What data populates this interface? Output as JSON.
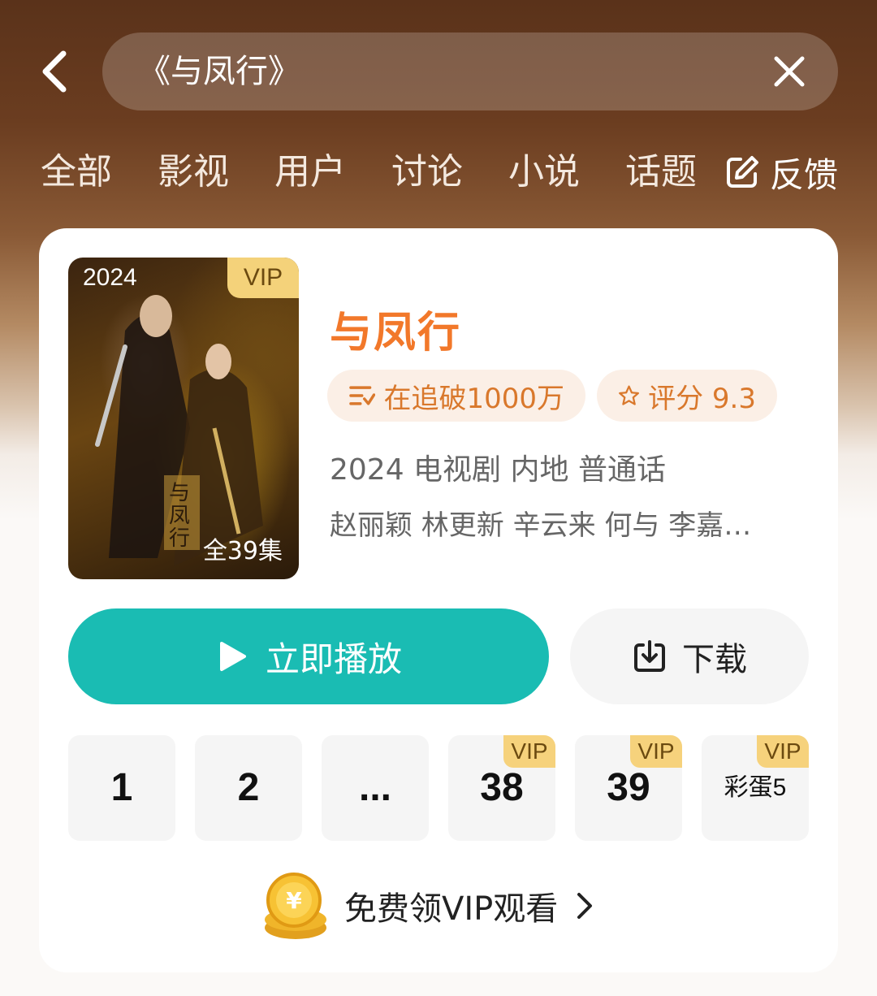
{
  "search": {
    "query": "《与凤行》"
  },
  "tabs": [
    {
      "label": "全部"
    },
    {
      "label": "影视"
    },
    {
      "label": "用户"
    },
    {
      "label": "讨论"
    },
    {
      "label": "小说"
    },
    {
      "label": "话题"
    }
  ],
  "feedback_label": "反馈",
  "show": {
    "poster": {
      "year": "2024",
      "vip": "VIP",
      "episodes": "全39集",
      "title_art": "与凤行"
    },
    "title": "与凤行",
    "follow": "在追破1000万",
    "rating": "评分 9.3",
    "meta": "2024 电视剧 内地 普通话",
    "cast": "赵丽颖 林更新 辛云来 何与 李嘉…"
  },
  "actions": {
    "play": "立即播放",
    "download": "下载"
  },
  "episodes": [
    {
      "label": "1",
      "vip": ""
    },
    {
      "label": "2",
      "vip": ""
    },
    {
      "label": "...",
      "vip": ""
    },
    {
      "label": "38",
      "vip": "VIP"
    },
    {
      "label": "39",
      "vip": "VIP"
    },
    {
      "label": "彩蛋5",
      "vip": "VIP"
    }
  ],
  "promo": {
    "label": "免费领VIP观看"
  },
  "colors": {
    "accent": "#f2782a",
    "play": "#1abcb3",
    "vip": "#f4d27a"
  }
}
